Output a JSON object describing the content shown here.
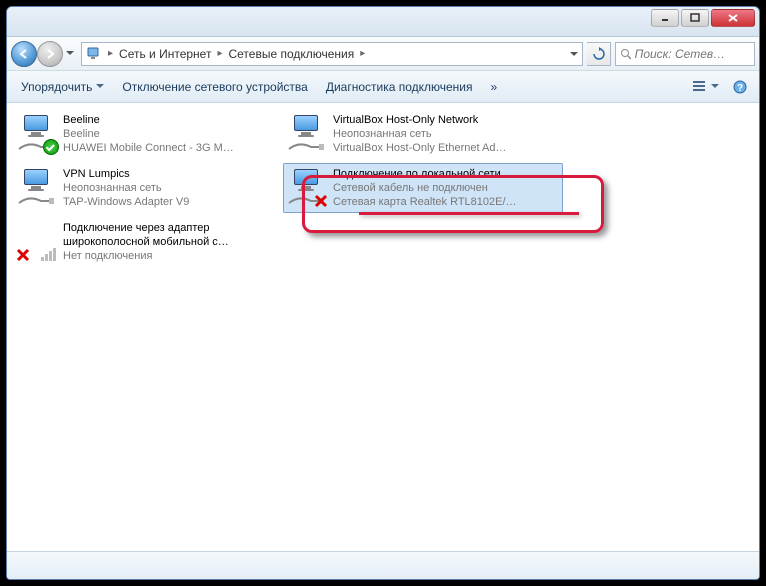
{
  "breadcrumb": {
    "part1": "Сеть и Интернет",
    "part2": "Сетевые подключения"
  },
  "search": {
    "placeholder": "Поиск: Сетев…"
  },
  "cmdbar": {
    "organize": "Упорядочить",
    "disable": "Отключение сетевого устройства",
    "diagnose": "Диагностика подключения",
    "more": "»"
  },
  "connections": [
    {
      "name": "Beeline",
      "sub1": "Beeline",
      "sub2": "HUAWEI Mobile Connect - 3G M…",
      "status": "ok"
    },
    {
      "name": "VirtualBox Host-Only Network",
      "sub1": "Неопознанная сеть",
      "sub2": "VirtualBox Host-Only Ethernet Ad…",
      "status": "plain"
    },
    {
      "name": "VPN Lumpics",
      "sub1": "Неопознанная сеть",
      "sub2": "TAP-Windows Adapter V9",
      "status": "plain"
    },
    {
      "name": "Подключение по локальной сети",
      "sub1": "Сетевой кабель не подключен",
      "sub2": "Сетевая карта Realtek RTL8102E/…",
      "status": "x",
      "selected": true
    },
    {
      "name": "Подключение через адаптер широкополосной мобильной с…",
      "sub1": "Нет подключения",
      "sub2": "",
      "status": "nosignal"
    }
  ]
}
